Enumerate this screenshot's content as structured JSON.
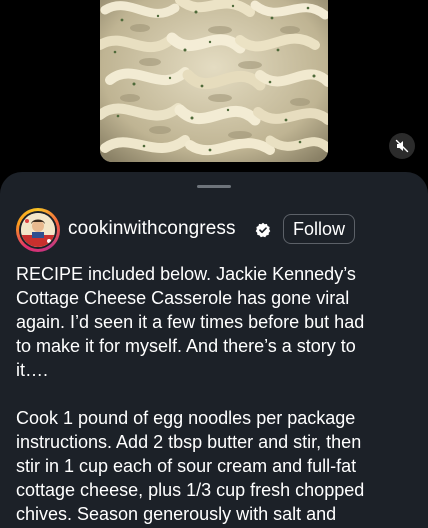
{
  "media": {
    "icon": "mute-icon"
  },
  "post": {
    "username": "cookinwithcongress",
    "verified_icon": "verified-badge-icon",
    "follow_label": "Follow",
    "caption_paragraph_1": "RECIPE included below. Jackie Kennedy’s\nCottage Cheese Casserole has gone viral\nagain. I’d seen it a few times before but had\nto make it for myself. And there’s a story to\nit….",
    "caption_paragraph_2": "Cook 1 pound of egg noodles per package\ninstructions. Add 2 tbsp butter and stir, then\nstir in 1 cup each of sour cream and full-fat\ncottage cheese, plus 1/3 cup fresh chopped\nchives. Season generously with salt and"
  },
  "colors": {
    "sheet_bg": "#1c2128",
    "text": "#ffffff",
    "follow_border": "#5c6168"
  }
}
